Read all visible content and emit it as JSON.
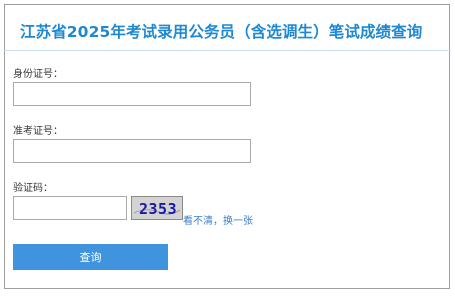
{
  "form": {
    "title": "江苏省2025年考试录用公务员（含选调生）笔试成绩查询",
    "id_number": {
      "label": "身份证号：",
      "value": "",
      "placeholder": ""
    },
    "ticket_number": {
      "label": "准考证号：",
      "value": "",
      "placeholder": ""
    },
    "captcha": {
      "label": "验证码：",
      "value": "",
      "placeholder": "",
      "image_text": "2353",
      "refresh_text": "看不清，换一张"
    },
    "submit_label": "查询"
  },
  "colors": {
    "title": "#1e88d2",
    "button": "#3f94dd",
    "link": "#3b7fc9",
    "captcha_bg": "#d3d3d3",
    "captcha_text": "#1a1aa0"
  }
}
